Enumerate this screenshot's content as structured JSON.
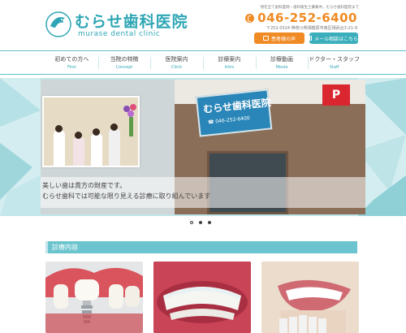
{
  "header": {
    "logo_jp": "むらせ歯科医院",
    "logo_en": "murase dental clinic",
    "note": "現在全て歯科医師・歯科衛生士募集中。むらせ歯科医院まで",
    "tel": "046-252-6400",
    "address": "〒252-0324 神奈川県相模原市南区相武台3-21-9",
    "btn_voice": "患者様の声",
    "btn_mail": "メール相談はこちら"
  },
  "nav": [
    {
      "jp": "初めての方へ",
      "en": "First"
    },
    {
      "jp": "当院の特徴",
      "en": "Concept"
    },
    {
      "jp": "医院案内",
      "en": "Clinic"
    },
    {
      "jp": "診療案内",
      "en": "Intro"
    },
    {
      "jp": "診療動画",
      "en": "Movie"
    },
    {
      "jp": "ドクター・スタッフ",
      "en": "Staff"
    }
  ],
  "hero": {
    "sign_text": "むらせ歯科医院",
    "sign_tel": "☎ 046-252-6400",
    "parking": "P",
    "line1": "美しい歯は貴方の財産です。",
    "line2": "むらせ歯科では可能な限り見える診療に取り組んでいます"
  },
  "section": {
    "title": "診療内容"
  },
  "colors": {
    "accent": "#2fa6b5",
    "orange": "#f08a24",
    "section_bar": "#6cc4ce"
  }
}
